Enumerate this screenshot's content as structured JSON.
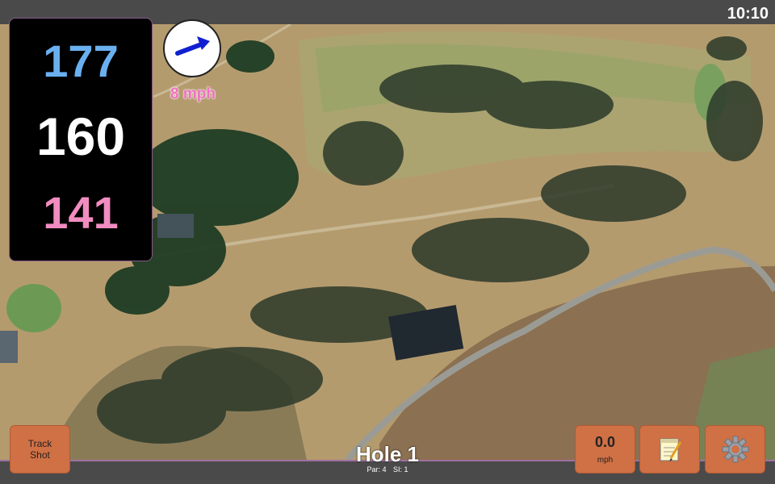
{
  "status": {
    "time": "10:10"
  },
  "distances": {
    "back": "177",
    "middle": "160",
    "front": "141"
  },
  "wind": {
    "speed_label": "8 mph",
    "direction_icon": "arrow-east-icon"
  },
  "hole": {
    "title": "Hole 1",
    "par": "Par: 4",
    "si": "SI: 1"
  },
  "buttons": {
    "track_shot_line1": "Track",
    "track_shot_line2": "Shot",
    "wind_value": "0.0",
    "wind_unit": "mph",
    "notes_icon": "notepad-icon",
    "settings_icon": "gear-icon"
  },
  "colors": {
    "back": "#6ab0f0",
    "middle": "#ffffff",
    "front": "#f08cc0",
    "button": "#d07045",
    "wind_text": "#f070c0"
  }
}
